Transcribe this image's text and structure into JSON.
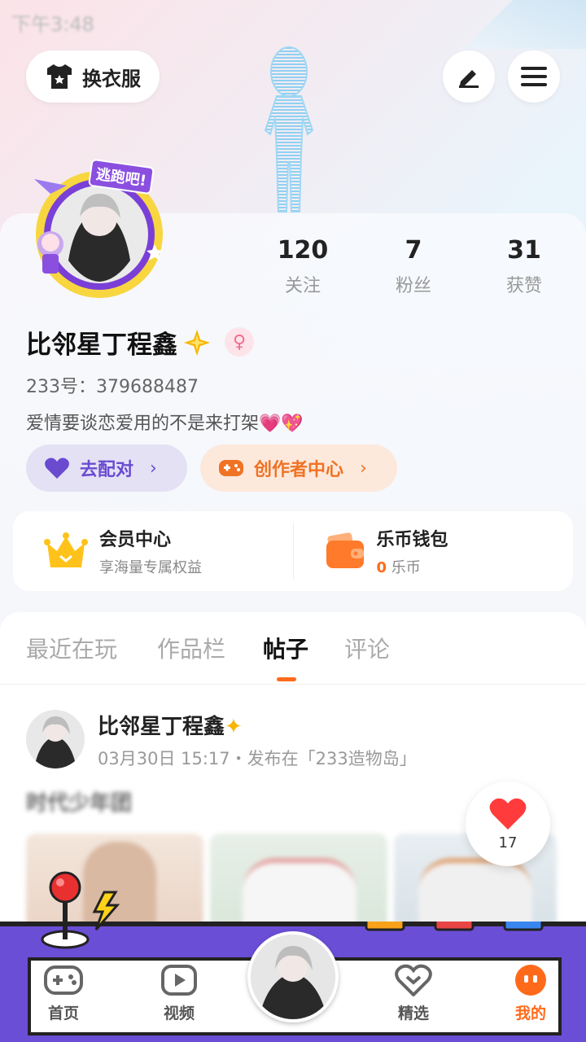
{
  "status_time": "下午3:48",
  "header": {
    "outfit_label": "换衣服"
  },
  "avatar_badge": "逃跑吧!",
  "stats": [
    {
      "value": "120",
      "label": "关注"
    },
    {
      "value": "7",
      "label": "粉丝"
    },
    {
      "value": "31",
      "label": "获赞"
    }
  ],
  "profile": {
    "name": "比邻星丁程鑫",
    "gender_symbol": "♀",
    "uid": "233号：379688487",
    "bio": "爱情要谈恋爱用的不是来打架"
  },
  "actions": {
    "match_label": "去配对",
    "creator_label": "创作者中心"
  },
  "vip": {
    "title": "会员中心",
    "subtitle": "享海量专属权益"
  },
  "wallet": {
    "title": "乐币钱包",
    "amount": "0",
    "unit": "乐币"
  },
  "tabs": [
    {
      "label": "最近在玩"
    },
    {
      "label": "作品栏"
    },
    {
      "label": "帖子"
    },
    {
      "label": "评论"
    }
  ],
  "post": {
    "author": "比邻星丁程鑫",
    "meta": "03月30日 15:17・发布在「233造物岛」",
    "text": "时代少年团",
    "like_count": "17"
  },
  "nav": {
    "home": "首页",
    "video": "视频",
    "featured": "精选",
    "mine": "我的"
  },
  "colors": {
    "accent": "#ff6a1a",
    "match": "#6a4bd0",
    "creator": "#f07224"
  }
}
